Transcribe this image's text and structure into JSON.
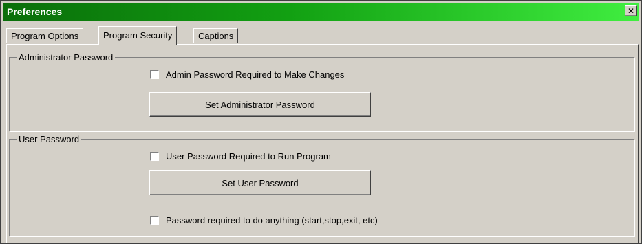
{
  "window": {
    "title": "Preferences",
    "close_glyph": "✕"
  },
  "tabs": [
    {
      "label": "Program Options",
      "active": false
    },
    {
      "label": "Program Security",
      "active": true
    },
    {
      "label": "Captions",
      "active": false
    }
  ],
  "admin_group": {
    "legend": "Administrator Password",
    "checkbox_label": "Admin Password Required to Make Changes",
    "checkbox_checked": false,
    "button_label": "Set Administrator Password"
  },
  "user_group": {
    "legend": "User Password",
    "checkbox_label": "User Password Required to Run Program",
    "checkbox_checked": false,
    "button_label": "Set User Password",
    "anything_checkbox_label": "Password required to do anything (start,stop,exit, etc)",
    "anything_checkbox_checked": false
  },
  "colors": {
    "titlebar_start": "#0a6e0a",
    "titlebar_end": "#40ee40",
    "face": "#d4d0c8"
  }
}
